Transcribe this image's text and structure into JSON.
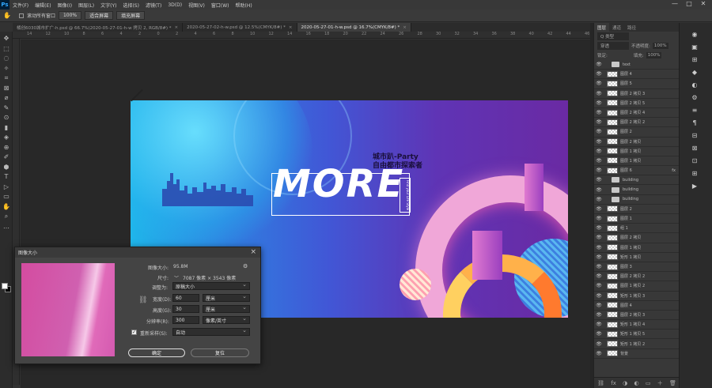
{
  "menubar": {
    "logo": "Ps",
    "items": [
      "文件(F)",
      "编辑(E)",
      "图像(I)",
      "图层(L)",
      "文字(Y)",
      "选择(S)",
      "滤镜(T)",
      "3D(D)",
      "视图(V)",
      "窗口(W)",
      "帮助(H)"
    ],
    "min": "—",
    "max": "□",
    "close": "✕"
  },
  "options": {
    "move_icon": "hand-icon",
    "check_label": "滚动所有窗口",
    "zoom": "100%",
    "fit_screen": "适合屏幕",
    "fill_screen": "填充屏幕"
  },
  "tabs": [
    {
      "label": "橘创6030城市扩广-h.psd @ 66.7%(2020-05-27-01-h-w 拷贝 2, RGB/8#) *",
      "close": "×"
    },
    {
      "label": "2020-05-27-02-h-w.psd @ 12.5%(CMYK/8#) *",
      "close": "×"
    },
    {
      "label": "2020-05-27-01-h-w.psd @ 16.7%(CMYK/8#) *",
      "close": "×"
    }
  ],
  "ruler_nums": [
    "14",
    "12",
    "10",
    "8",
    "6",
    "4",
    "2",
    "0",
    "2",
    "4",
    "6",
    "8",
    "10",
    "12",
    "14",
    "16",
    "18",
    "20",
    "22",
    "24",
    "26",
    "28",
    "30",
    "32",
    "34",
    "36",
    "38",
    "40",
    "42",
    "44",
    "46"
  ],
  "tools": [
    "✥",
    "⬚",
    "◌",
    "✧",
    "⌗",
    "⊠",
    "⌀",
    "✎",
    "⊙",
    "▮",
    "◈",
    "⊕",
    "✐",
    "⬢",
    "T",
    "▷",
    "▭",
    "✋",
    "⌕",
    "…"
  ],
  "artwork": {
    "main_text": "MORE",
    "subtitle_line1": "城市趴-Party",
    "subtitle_line2": "自由都市探索者",
    "vertical_text": "Find your Life Style"
  },
  "dialog": {
    "title": "图像大小",
    "close": "×",
    "size_label": "图像大小:",
    "size_value": "95.8M",
    "dim_label": "尺寸:",
    "dim_value": "7087 像素 × 3543 像素",
    "gear": "⚙",
    "fit_label": "调整为:",
    "fit_value": "原稿大小",
    "width_label": "宽度(D):",
    "width_value": "60",
    "width_unit": "厘米",
    "height_label": "高度(G):",
    "height_value": "30",
    "height_unit": "厘米",
    "res_label": "分辨率(R):",
    "res_value": "300",
    "res_unit": "像素/英寸",
    "resample_label": "重新采样(S):",
    "resample_value": "自动",
    "ok": "确定",
    "reset": "复位",
    "checkmark": "✓"
  },
  "layers_panel": {
    "tabs": [
      "图层",
      "通道",
      "路径"
    ],
    "kind_label": "Q 类型",
    "blend": "穿透",
    "opacity_label": "不透明度:",
    "opacity": "100%",
    "lock_label": "锁定:",
    "fill_label": "填充:",
    "fill": "100%",
    "layers": [
      {
        "name": "text",
        "type": "folder"
      },
      {
        "name": "图层 4",
        "type": "layer"
      },
      {
        "name": "图层 5",
        "type": "layer"
      },
      {
        "name": "图层 2 拷贝 3",
        "type": "layer"
      },
      {
        "name": "图层 2 拷贝 5",
        "type": "layer"
      },
      {
        "name": "图层 2 拷贝 4",
        "type": "layer"
      },
      {
        "name": "图层 2 拷贝 2",
        "type": "layer"
      },
      {
        "name": "图层 2",
        "type": "layer"
      },
      {
        "name": "图层 2 拷贝",
        "type": "layer"
      },
      {
        "name": "图层 1 拷贝",
        "type": "layer"
      },
      {
        "name": "图层 1 拷贝",
        "type": "layer"
      },
      {
        "name": "图层 6",
        "type": "layer"
      },
      {
        "name": "building",
        "type": "folder"
      },
      {
        "name": "building",
        "type": "folder"
      },
      {
        "name": "building",
        "type": "folder"
      },
      {
        "name": "图层 2",
        "type": "layer"
      },
      {
        "name": "图层 1",
        "type": "layer"
      },
      {
        "name": "组 1",
        "type": "layer"
      },
      {
        "name": "图层 2 拷贝",
        "type": "layer"
      },
      {
        "name": "图层 1 拷贝",
        "type": "layer"
      },
      {
        "name": "矩形 1 拷贝",
        "type": "layer"
      },
      {
        "name": "图层 3",
        "type": "layer"
      },
      {
        "name": "图层 2 拷贝 2",
        "type": "layer"
      },
      {
        "name": "图层 1 拷贝 2",
        "type": "layer"
      },
      {
        "name": "矩形 1 拷贝 3",
        "type": "layer"
      },
      {
        "name": "图层 4",
        "type": "layer"
      },
      {
        "name": "图层 2 拷贝 3",
        "type": "layer"
      },
      {
        "name": "矩形 1 拷贝 4",
        "type": "layer"
      },
      {
        "name": "矩形 1 拷贝 5",
        "type": "layer"
      },
      {
        "name": "矩形 1 拷贝 2",
        "type": "layer"
      },
      {
        "name": "背景",
        "type": "layer"
      }
    ],
    "fx": "fx",
    "bottom_icons": [
      "⛓",
      "fx",
      "◑",
      "◐",
      "▭",
      "＋",
      "🗑"
    ]
  },
  "iconbar": [
    "◉",
    "▣",
    "⊞",
    "◆",
    "◐",
    "⚙",
    "≡",
    "¶",
    "⊟",
    "⊠",
    "⊡",
    "⊞",
    "▶"
  ],
  "colors": {
    "accent": "#31a8ff",
    "artwork_start": "#1fb6ea",
    "artwork_end": "#6a2aa3"
  }
}
